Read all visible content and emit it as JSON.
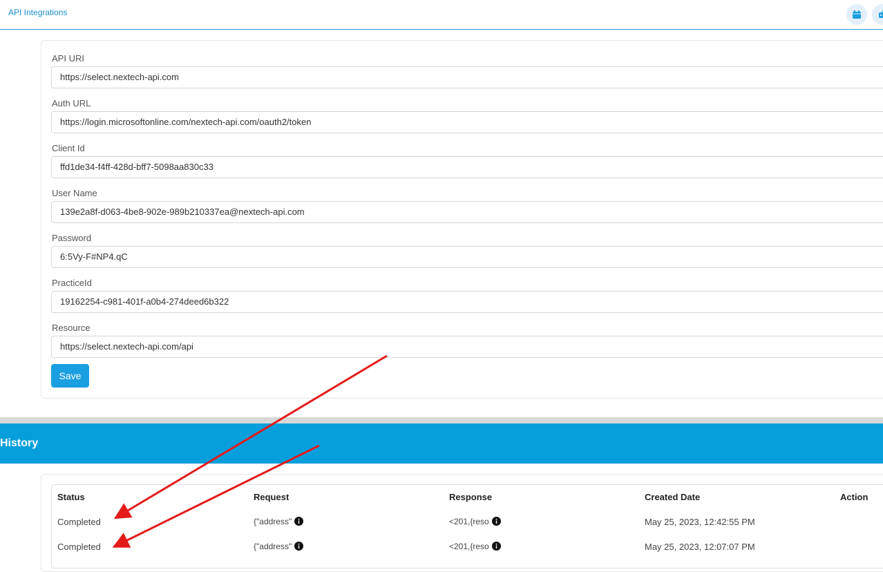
{
  "header": {
    "title": "API Integrations",
    "icons": [
      "calendar-icon",
      "robot-icon"
    ]
  },
  "form": {
    "fields": [
      {
        "label": "API URI",
        "value": "https://select.nextech-api.com"
      },
      {
        "label": "Auth URL",
        "value": "https://login.microsoftonline.com/nextech-api.com/oauth2/token"
      },
      {
        "label": "Client Id",
        "value": "ffd1de34-f4ff-428d-bff7-5098aa830c33"
      },
      {
        "label": "User Name",
        "value": "139e2a8f-d063-4be8-902e-989b210337ea@nextech-api.com"
      },
      {
        "label": "Password",
        "value": "6:5Vy-F#NP4.qC"
      },
      {
        "label": "PracticeId",
        "value": "19162254-c981-401f-a0b4-274deed6b322"
      },
      {
        "label": "Resource",
        "value": "https://select.nextech-api.com/api"
      }
    ],
    "save_label": "Save"
  },
  "history": {
    "title": "History",
    "columns": [
      "Status",
      "Request",
      "Response",
      "Created Date",
      "Action"
    ],
    "rows": [
      {
        "status": "Completed",
        "request": "{\"address\"",
        "response": "<201,{reso",
        "created": "May 25, 2023, 12:42:55 PM"
      },
      {
        "status": "Completed",
        "request": "{\"address\"",
        "response": "<201,{reso",
        "created": "May 25, 2023, 12:07:07 PM"
      }
    ]
  },
  "colors": {
    "accent": "#069fdc",
    "link": "#1a8fd0",
    "arrow": "#e31b1b"
  }
}
